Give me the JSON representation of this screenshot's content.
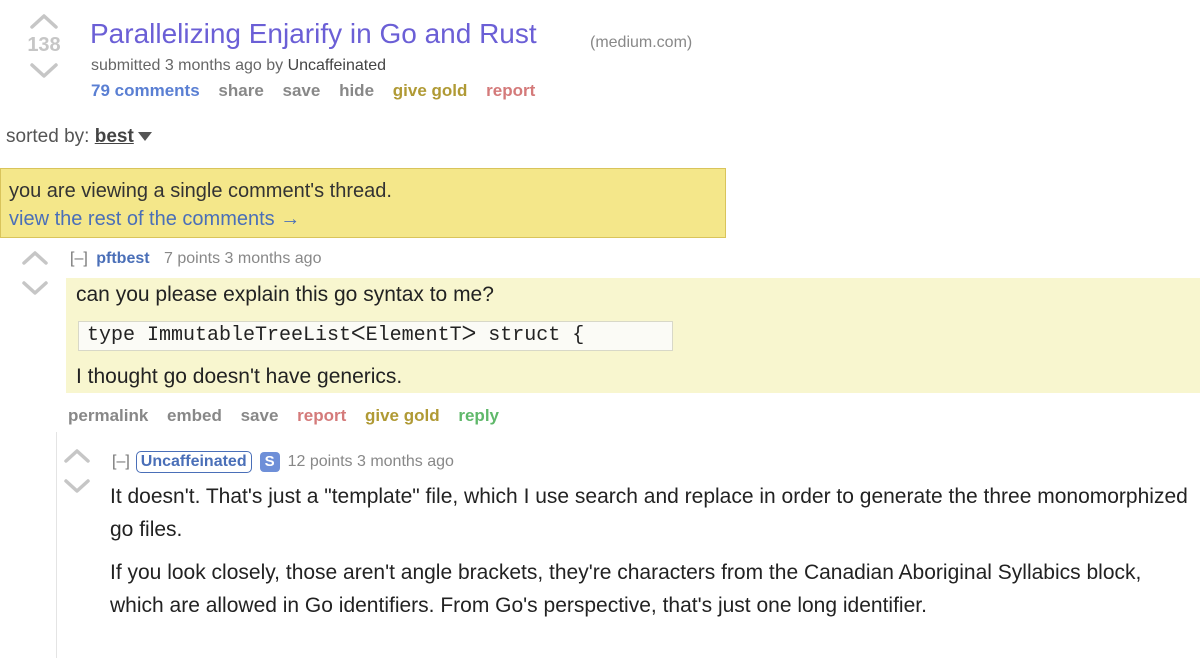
{
  "post": {
    "score": "138",
    "title": "Parallelizing Enjarify in Go and Rust",
    "domain": "(medium.com)",
    "tagline_prefix": "submitted 3 months ago by ",
    "author": "Uncaffeinated",
    "buttons": {
      "comments": "79 comments",
      "share": "share",
      "save": "save",
      "hide": "hide",
      "give_gold": "give gold",
      "report": "report"
    }
  },
  "sort": {
    "label": "sorted by: ",
    "value": "best"
  },
  "infobar": {
    "message": "you are viewing a single comment's thread.",
    "link": "view the rest of the comments →"
  },
  "comments": [
    {
      "toggle": "[–]",
      "author": "pftbest",
      "meta": "7 points 3 months ago",
      "line1": "can you please explain this go syntax to me?",
      "code": "type ImmutableTreeListᐸElementTᐳ struct {",
      "line3": "I thought go doesn't have generics.",
      "buttons": {
        "permalink": "permalink",
        "embed": "embed",
        "save": "save",
        "report": "report",
        "give_gold": "give gold",
        "reply": "reply"
      }
    },
    {
      "toggle": "[–]",
      "author": "Uncaffeinated",
      "badge": "S",
      "meta": "12 points 3 months ago",
      "paragraph1": "It doesn't. That's just a \"template\" file, which I use search and replace in order to generate the three monomorphized go files.",
      "paragraph2": "If you look closely, those aren't angle brackets, they're characters from the Canadian Aboriginal Syllabics block, which are allowed in Go identifiers. From Go's perspective, that's just one long identifier."
    }
  ],
  "colors": {
    "title": "#6b5fd6",
    "link_blue": "#4a6fb8",
    "infobar_bg": "#f4e78a",
    "comment_highlight": "#f8f6cf",
    "gold": "#b09a35",
    "report": "#d47a7a",
    "reply": "#5fb86a"
  },
  "icons": {
    "upvote": "upvote-arrow-icon",
    "downvote": "downvote-arrow-icon",
    "sort_caret": "caret-down-icon"
  }
}
